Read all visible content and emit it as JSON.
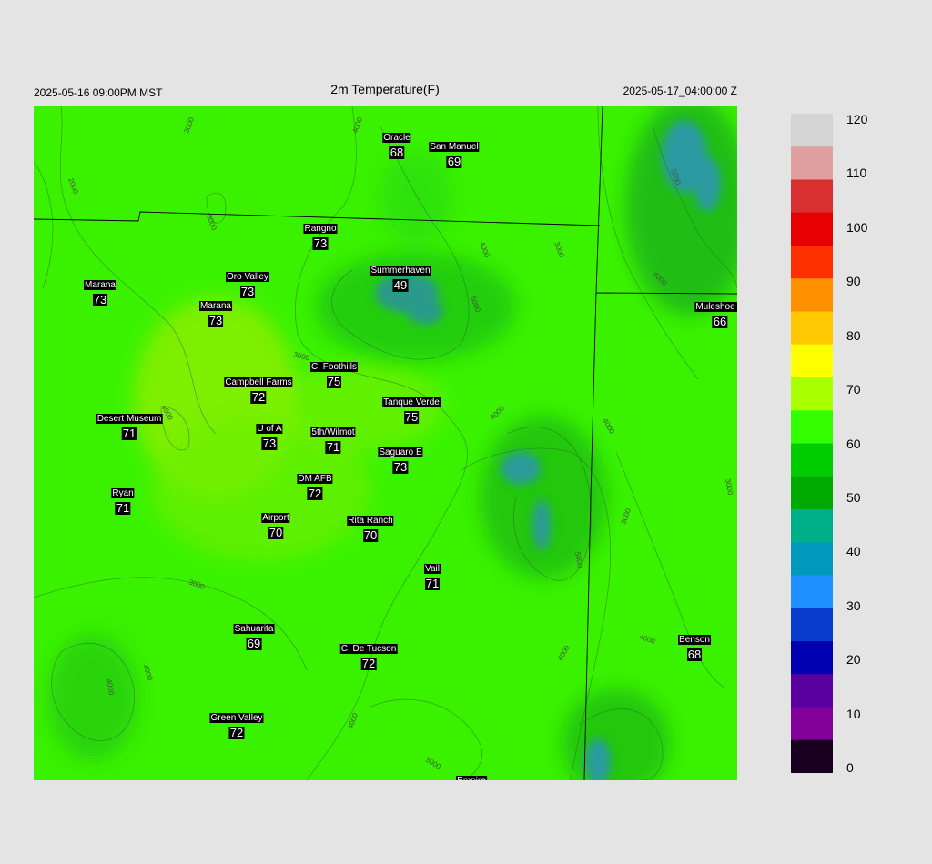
{
  "header": {
    "local_time": "2025-05-16 09:00PM MST",
    "title": "2m Temperature(F)",
    "valid_time": "2025-05-17_04:00:00 Z"
  },
  "stations": [
    {
      "name": "Oracle",
      "value": "68"
    },
    {
      "name": "San Manuel",
      "value": "69"
    },
    {
      "name": "Rangno",
      "value": "73"
    },
    {
      "name": "Summerhaven",
      "value": "49"
    },
    {
      "name": "Marana",
      "value": "73"
    },
    {
      "name": "Oro Valley",
      "value": "73"
    },
    {
      "name": "Marana",
      "value": "73"
    },
    {
      "name": "Muleshoe R",
      "value": "66"
    },
    {
      "name": "C. Foothills",
      "value": "75"
    },
    {
      "name": "Campbell Farms",
      "value": "72"
    },
    {
      "name": "Tanque Verde",
      "value": "75"
    },
    {
      "name": "Desert Museum",
      "value": "71"
    },
    {
      "name": "U of A",
      "value": "73"
    },
    {
      "name": "5th/Wilmot",
      "value": "71"
    },
    {
      "name": "Saguaro E",
      "value": "73"
    },
    {
      "name": "DM AFB",
      "value": "72"
    },
    {
      "name": "Ryan",
      "value": "71"
    },
    {
      "name": "Airport",
      "value": "70"
    },
    {
      "name": "Rita Ranch",
      "value": "70"
    },
    {
      "name": "Vail",
      "value": "71"
    },
    {
      "name": "Sahuarita",
      "value": "69"
    },
    {
      "name": "C. De Tucson",
      "value": "72"
    },
    {
      "name": "Benson",
      "value": "68"
    },
    {
      "name": "Green Valley",
      "value": "72"
    },
    {
      "name": "Empire",
      "value": ""
    }
  ],
  "contour_labels": [
    "3000",
    "2000",
    "3000",
    "4000",
    "4000",
    "5000",
    "3000",
    "4000",
    "3000",
    "4000",
    "5000",
    "4000",
    "5000",
    "4000",
    "3000",
    "3000",
    "4000",
    "3000",
    "4000",
    "4000",
    "4000",
    "5000",
    "4000"
  ],
  "colorbar": {
    "ticks": [
      "120",
      "110",
      "100",
      "90",
      "80",
      "70",
      "60",
      "50",
      "40",
      "30",
      "20",
      "10",
      "0"
    ],
    "colors": [
      "#d4d4d4",
      "#e0a0a0",
      "#d83030",
      "#e60000",
      "#ff3000",
      "#ff9000",
      "#ffc800",
      "#ffff00",
      "#aaff00",
      "#33ff00",
      "#00cc00",
      "#00aa00",
      "#00b088",
      "#0099bb",
      "#1e90ff",
      "#0a3ccc",
      "#0000b0",
      "#5a00a0",
      "#800099",
      "#1a0020"
    ]
  }
}
